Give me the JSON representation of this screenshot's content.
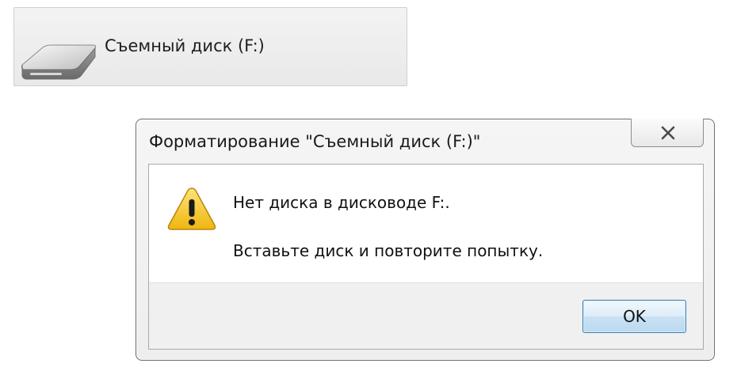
{
  "drive": {
    "label": "Съемный диск (F:)",
    "icon": "removable-drive-icon"
  },
  "dialog": {
    "title": "Форматирование \"Съемный диск (F:)\"",
    "close_icon": "close-icon",
    "warning_icon": "warning-icon",
    "message_line1": "Нет диска в дисководе F:.",
    "message_line2": "Вставьте диск и повторите попытку.",
    "ok_label": "OK"
  },
  "colors": {
    "warning_yellow": "#f5c51a",
    "button_border": "#3c7fb1"
  }
}
